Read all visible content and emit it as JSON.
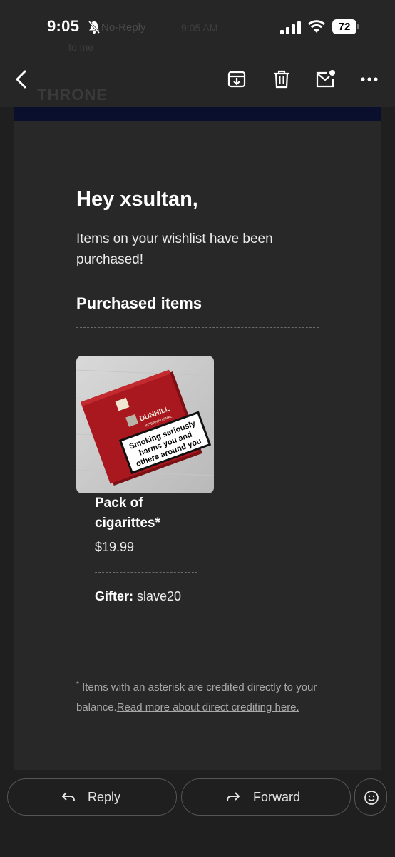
{
  "status_bar": {
    "time": "9:05",
    "battery": "72",
    "icons": [
      "bell-slash-icon",
      "signal-icon",
      "wifi-icon",
      "battery-icon"
    ]
  },
  "background_header": {
    "sender": "No-Reply",
    "time": "9:05 AM",
    "to": "to me",
    "logo": "THRONE"
  },
  "toolbar": {
    "icons": [
      "back-icon",
      "archive-icon",
      "trash-icon",
      "mark-unread-icon",
      "more-icon"
    ]
  },
  "email": {
    "greeting": "Hey xsultan,",
    "intro": "Items on your wishlist have been purchased!",
    "section_title": "Purchased items",
    "item": {
      "image_label": "cigarette-pack-image",
      "name": "Pack of cigarittes*",
      "price": "$19.99",
      "gifter_label": "Gifter:",
      "gifter_name": "slave20"
    },
    "footnote_mark": "*",
    "footnote_text": "Items with an asterisk are credited directly to your balance.",
    "footnote_link": "Read more about direct crediting here.",
    "colors": {
      "header_band": "#0b0f2e",
      "card_bg": "#292828"
    }
  },
  "actions": {
    "reply_label": "Reply",
    "forward_label": "Forward"
  }
}
